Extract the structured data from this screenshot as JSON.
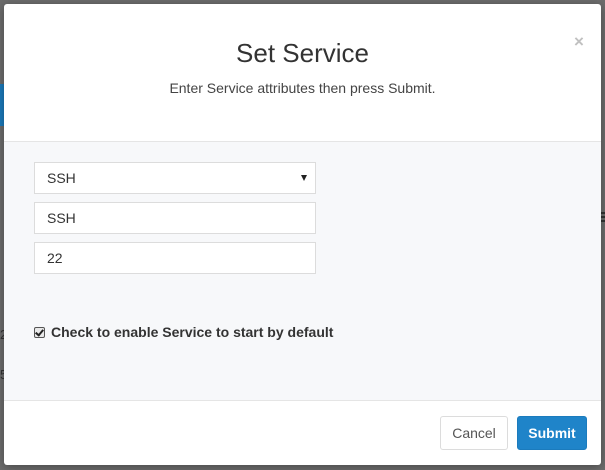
{
  "modal": {
    "title": "Set Service",
    "subtitle": "Enter Service attributes then press Submit.",
    "close_glyph": "×"
  },
  "form": {
    "service_select": {
      "selected": "SSH"
    },
    "service_name": {
      "value": "SSH"
    },
    "port": {
      "value": "22"
    },
    "enable_checkbox": {
      "checked": true,
      "label": "Check to enable Service to start by default"
    }
  },
  "footer": {
    "cancel_label": "Cancel",
    "submit_label": "Submit"
  },
  "background": {
    "fragments": [
      "2",
      "5"
    ]
  },
  "colors": {
    "primary": "#1f84c9",
    "body_bg": "#f7f8fa",
    "overlay": "#6d6d6d"
  }
}
